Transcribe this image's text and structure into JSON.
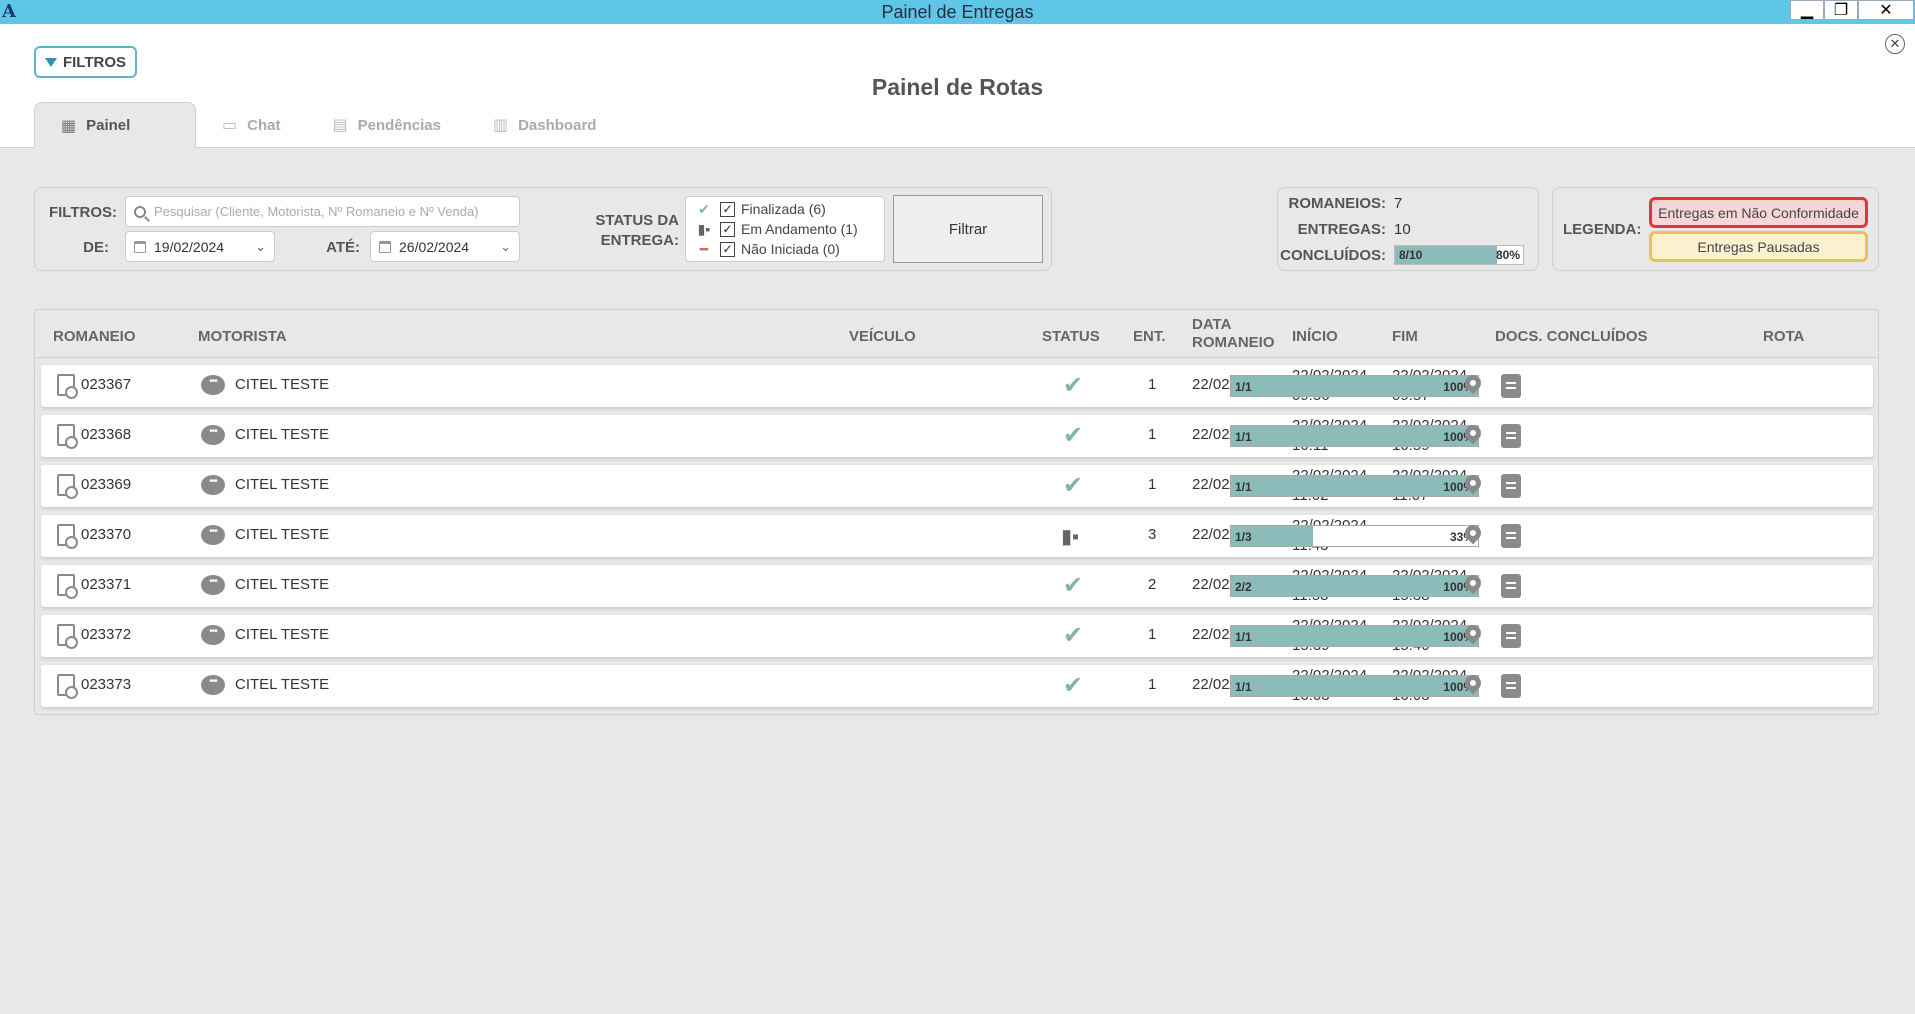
{
  "window": {
    "title": "Painel de Entregas",
    "app_icon": "A",
    "min_glyph": "▁",
    "max_glyph": "❐",
    "close_glyph": "✕"
  },
  "header": {
    "filters_button": "FILTROS",
    "close_glyph": "✕",
    "page_title": "Painel de Rotas",
    "tabs": [
      {
        "label": "Painel",
        "icon": "map-icon",
        "active": true
      },
      {
        "label": "Chat",
        "icon": "chat-icon",
        "active": false
      },
      {
        "label": "Pendências",
        "icon": "document-icon",
        "active": false
      },
      {
        "label": "Dashboard",
        "icon": "bar-chart-icon",
        "active": false
      }
    ]
  },
  "filters": {
    "filtros_label": "FILTROS:",
    "search_placeholder": "Pesquisar (Cliente, Motorista, Nº Romaneio e Nº Venda)",
    "de_label": "DE:",
    "de_value": "19/02/2024",
    "ate_label": "ATÉ:",
    "ate_value": "26/02/2024",
    "status_label_1": "STATUS DA",
    "status_label_2": "ENTREGA:",
    "status_options": [
      {
        "label": "Finalizada (6)",
        "icon": "check-icon",
        "checked": true
      },
      {
        "label": "Em Andamento (1)",
        "icon": "truck-icon",
        "checked": true
      },
      {
        "label": "Não Iniciada (0)",
        "icon": "dash-icon",
        "checked": true
      }
    ],
    "filter_button": "Filtrar",
    "check_glyph": "✓"
  },
  "summary": {
    "romaneios_label": "ROMANEIOS:",
    "romaneios_value": "7",
    "entregas_label": "ENTREGAS:",
    "entregas_value": "10",
    "concluidos_label": "CONCLUÍDOS:",
    "concluidos_text": "8/10",
    "concluidos_pct_text": "80%",
    "concluidos_fraction": 0.8
  },
  "legend": {
    "label": "LEGENDA:",
    "non_conformity": "Entregas em Não Conformidade",
    "paused": "Entregas Pausadas",
    "non_conformity_border": "#e0353b",
    "non_conformity_bg": "#f6d6d6",
    "paused_border": "#e8c25a",
    "paused_bg": "#fbf0cf"
  },
  "table": {
    "headers": {
      "romaneio": "ROMANEIO",
      "motorista": "MOTORISTA",
      "veiculo": "VEÍCULO",
      "status": "STATUS",
      "ent": "ENT.",
      "data_romaneio_1": "DATA",
      "data_romaneio_2": "ROMANEIO",
      "inicio": "INÍCIO",
      "fim": "FIM",
      "docs": "DOCS. CONCLUÍDOS",
      "rota": "ROTA"
    },
    "rows": [
      {
        "romaneio": "023367",
        "motorista": "CITEL TESTE",
        "veiculo": "",
        "status": "finalizada",
        "ent": "1",
        "data": "22/02/2024",
        "inicio_d": "22/02/2024",
        "inicio_t": "09:56",
        "fim_d": "22/02/2024",
        "fim_t": "09:57",
        "docs": "1/1",
        "pct": "100%",
        "fraction": 1.0
      },
      {
        "romaneio": "023368",
        "motorista": "CITEL TESTE",
        "veiculo": "",
        "status": "finalizada",
        "ent": "1",
        "data": "22/02/2024",
        "inicio_d": "22/02/2024",
        "inicio_t": "10:11",
        "fim_d": "22/02/2024",
        "fim_t": "10:59",
        "docs": "1/1",
        "pct": "100%",
        "fraction": 1.0
      },
      {
        "romaneio": "023369",
        "motorista": "CITEL TESTE",
        "veiculo": "",
        "status": "finalizada",
        "ent": "1",
        "data": "22/02/2024",
        "inicio_d": "22/02/2024",
        "inicio_t": "11:02",
        "fim_d": "22/02/2024",
        "fim_t": "11:07",
        "docs": "1/1",
        "pct": "100%",
        "fraction": 1.0
      },
      {
        "romaneio": "023370",
        "motorista": "CITEL TESTE",
        "veiculo": "",
        "status": "em_andamento",
        "ent": "3",
        "data": "22/02/2024",
        "inicio_d": "22/02/2024",
        "inicio_t": "11:43",
        "fim_d": "",
        "fim_t": "",
        "docs": "1/3",
        "pct": "33%",
        "fraction": 0.33
      },
      {
        "romaneio": "023371",
        "motorista": "CITEL TESTE",
        "veiculo": "",
        "status": "finalizada",
        "ent": "2",
        "data": "22/02/2024",
        "inicio_d": "22/02/2024",
        "inicio_t": "11:58",
        "fim_d": "22/02/2024",
        "fim_t": "15:38",
        "docs": "2/2",
        "pct": "100%",
        "fraction": 1.0
      },
      {
        "romaneio": "023372",
        "motorista": "CITEL TESTE",
        "veiculo": "",
        "status": "finalizada",
        "ent": "1",
        "data": "22/02/2024",
        "inicio_d": "22/02/2024",
        "inicio_t": "15:39",
        "fim_d": "22/02/2024",
        "fim_t": "15:40",
        "docs": "1/1",
        "pct": "100%",
        "fraction": 1.0
      },
      {
        "romaneio": "023373",
        "motorista": "CITEL TESTE",
        "veiculo": "",
        "status": "finalizada",
        "ent": "1",
        "data": "22/02/2024",
        "inicio_d": "22/02/2024",
        "inicio_t": "16:03",
        "fim_d": "22/02/2024",
        "fim_t": "16:03",
        "docs": "1/1",
        "pct": "100%",
        "fraction": 1.0
      }
    ]
  },
  "colors": {
    "accent": "#5fc6e8",
    "progress": "#8cbcba",
    "check": "#7fb4b3"
  },
  "glyphs": {
    "check": "✔",
    "truck": "🚚",
    "dash": "━",
    "chat": "•••",
    "chevron": "⌄"
  }
}
